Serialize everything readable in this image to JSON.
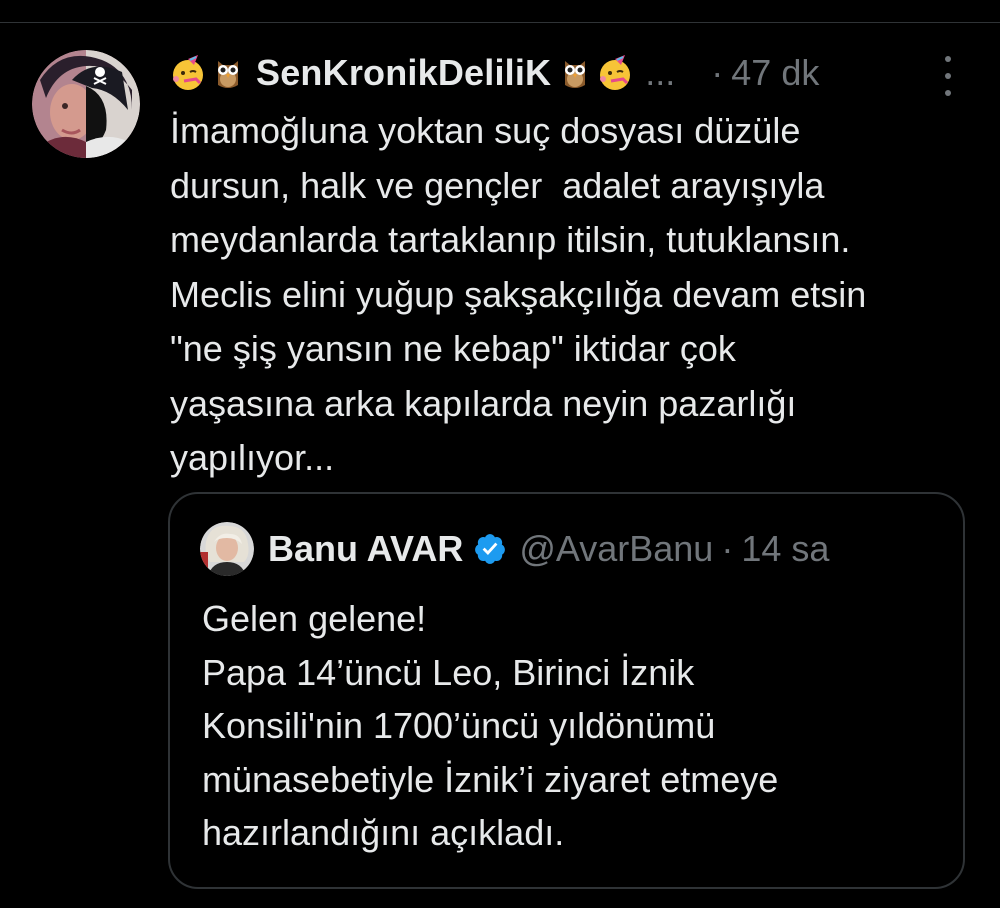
{
  "tweet": {
    "display_name": "SenKronikDeliliK",
    "name_overflow": "...",
    "separator": "·",
    "time": "47 dk",
    "emojis_left": [
      "party-face-icon",
      "owl-icon"
    ],
    "emojis_right": [
      "owl-icon",
      "party-face-icon"
    ],
    "text_lines": [
      "İmamoğluna yoktan suç dosyası düzüle",
      "dursun, halk ve gençler  adalet arayışıyla",
      "meydanlarda tartaklanıp itilsin, tutuklansın.",
      "Meclis elini yuğup şakşakçılığa devam etsin",
      "\"ne şiş yansın ne kebap\" iktidar çok",
      "yaşasına arka kapılarda neyin pazarlığı",
      "yapılıyor..."
    ]
  },
  "quote": {
    "name": "Banu AVAR",
    "handle": "@AvarBanu",
    "separator": "·",
    "time": "14 sa",
    "verified": true,
    "text_lines": [
      "Gelen gelene!",
      "Papa 14’üncü Leo, Birinci İznik",
      "Konsili'nin 1700’üncü yıldönümü",
      "münasebetiyle İznik’i ziyaret etmeye",
      "hazırlandığını açıkladı."
    ]
  },
  "colors": {
    "background": "#000000",
    "text": "#e7e9ea",
    "secondary_text": "#71767b",
    "border": "#2f3336",
    "verified_blue": "#1d9bf0"
  }
}
